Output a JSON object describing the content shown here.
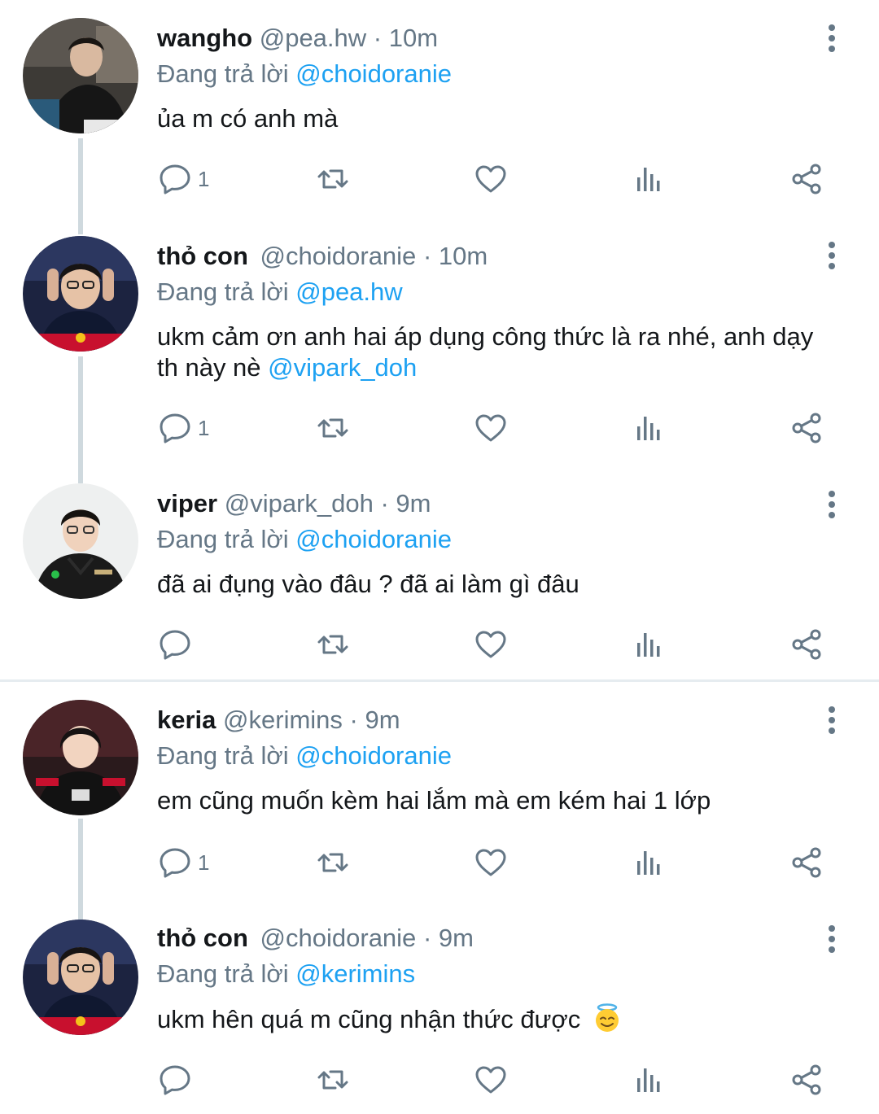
{
  "tweets": [
    {
      "name": "wangho",
      "handle": "@pea.hw",
      "time": "· 10m",
      "reply_prefix": "Đang trả lời ",
      "reply_to": "@choidoranie",
      "text": "ủa m có anh mà",
      "reply_count": "1"
    },
    {
      "name": "thỏ con",
      "handle": "@choidoranie",
      "time": "· 10m",
      "reply_prefix": "Đang trả lời ",
      "reply_to": "@pea.hw",
      "text_line1": "ukm cảm ơn anh hai áp dụng công thức là ra nhé, anh dạy",
      "text_line2_prefix": "th này nè ",
      "text_mention": "@vipark_doh",
      "reply_count": "1"
    },
    {
      "name": "viper",
      "handle": "@vipark_doh",
      "time": "· 9m",
      "reply_prefix": "Đang trả lời ",
      "reply_to": "@choidoranie",
      "text": "đã ai đụng vào đâu ? đã ai làm gì đâu",
      "reply_count": ""
    },
    {
      "name": "keria",
      "handle": "@kerimins",
      "time": "· 9m",
      "reply_prefix": "Đang trả lời ",
      "reply_to": "@choidoranie",
      "text": "em cũng muốn kèm hai lắm mà em kém hai 1 lớp",
      "reply_count": "1"
    },
    {
      "name": "thỏ con",
      "handle": "@choidoranie",
      "time": "· 9m",
      "reply_prefix": "Đang trả lời ",
      "reply_to": "@kerimins",
      "text": "ukm hên quá m cũng nhận thức được",
      "emoji": "smiling-face-with-halo",
      "reply_count": ""
    }
  ],
  "icons": [
    "reply-icon",
    "retweet-icon",
    "like-icon",
    "analytics-icon",
    "share-icon",
    "more-options-icon"
  ],
  "colors": {
    "text": "#14171a",
    "secondary": "#657786",
    "mention": "#1da1f2",
    "thread_line": "#cfd9de",
    "divider": "#e6ecf0"
  }
}
